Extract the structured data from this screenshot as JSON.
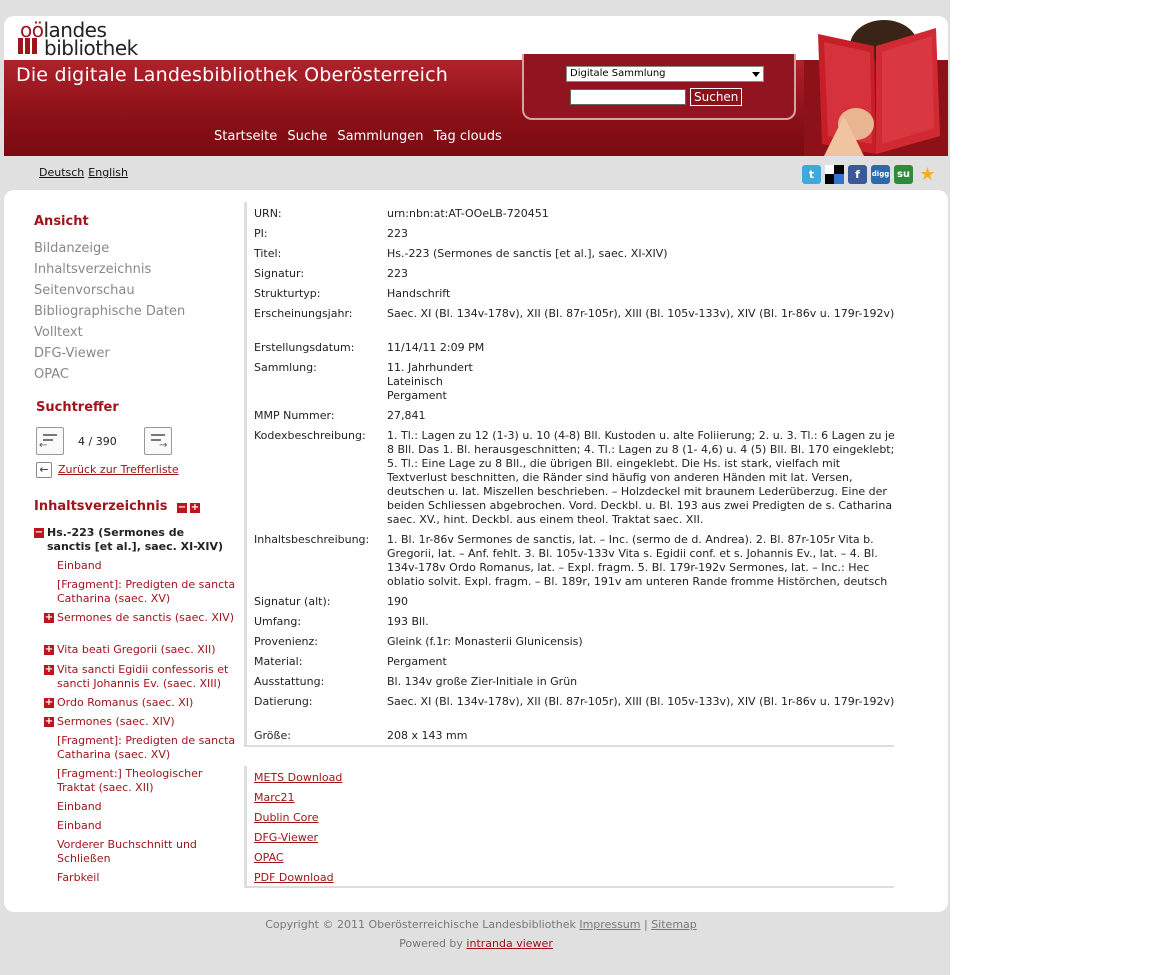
{
  "logo": {
    "oo": "oö",
    "line1": "landes",
    "line2": "bibliothek"
  },
  "banner_title": "Die digitale Landesbibliothek Oberösterreich",
  "search": {
    "select_value": "Digitale Sammlung",
    "button": "Suchen"
  },
  "nav": [
    "Startseite",
    "Suche",
    "Sammlungen",
    "Tag clouds"
  ],
  "languages": [
    "Deutsch",
    "English"
  ],
  "social_icons": [
    "twitter-icon",
    "delicious-icon",
    "facebook-icon",
    "digg-icon",
    "stumbleupon-icon",
    "favorite-star-icon"
  ],
  "colors": {
    "brand": "#a0141c",
    "banner_dark": "#7a0b12"
  },
  "sidebar": {
    "view_heading": "Ansicht",
    "view_items": [
      "Bildanzeige",
      "Inhaltsverzeichnis",
      "Seitenvorschau",
      "Bibliographische Daten",
      "Volltext",
      "DFG-Viewer",
      "OPAC"
    ],
    "hits_heading": "Suchtreffer",
    "hits_position": "4 / 390",
    "back_link": "Zurück zur Trefferliste",
    "toc_heading": "Inhaltsverzeichnis",
    "toc_root": "Hs.-223 (Sermones de sanctis [et al.], saec. XI-XIV)",
    "toc_items": [
      {
        "label": "Einband",
        "expandable": false
      },
      {
        "label": "[Fragment]: Predigten de sancta Catharina (saec. XV)",
        "expandable": false
      },
      {
        "label": "Sermones de sanctis (saec. XIV)",
        "expandable": true
      },
      {
        "label": "Vita beati Gregorii (saec. XII)",
        "expandable": true
      },
      {
        "label": "Vita sancti Egidii confessoris et sancti Johannis Ev. (saec. XIII)",
        "expandable": true
      },
      {
        "label": "Ordo Romanus (saec. XI)",
        "expandable": true
      },
      {
        "label": "Sermones (saec. XIV)",
        "expandable": true
      },
      {
        "label": "[Fragment]: Predigten de sancta Catharina (saec. XV)",
        "expandable": false
      },
      {
        "label": "[Fragment:] Theologischer Traktat (saec. XII)",
        "expandable": false
      },
      {
        "label": "Einband",
        "expandable": false
      },
      {
        "label": "Einband",
        "expandable": false
      },
      {
        "label": "Vorderer Buchschnitt und Schließen",
        "expandable": false
      },
      {
        "label": "Farbkeil",
        "expandable": false
      }
    ]
  },
  "metadata": [
    {
      "key": "URN:",
      "value": "urn:nbn:at:AT-OOeLB-720451"
    },
    {
      "key": "PI:",
      "value": "223"
    },
    {
      "key": "Titel:",
      "value": "Hs.-223 (Sermones de sanctis [et al.], saec. XI-XIV)"
    },
    {
      "key": "Signatur:",
      "value": "223"
    },
    {
      "key": "Strukturtyp:",
      "value": "Handschrift"
    },
    {
      "key": "Erscheinungsjahr:",
      "value": "Saec. XI (Bl. 134v-178v), XII (Bl. 87r-105r), XIII (Bl. 105v-133v), XIV (Bl. 1r-86v u. 179r-192v)"
    },
    {
      "key": "Erstellungsdatum:",
      "value": "11/14/11 2:09 PM"
    },
    {
      "key": "Sammlung:",
      "value": "11. Jahrhundert\nLateinisch\nPergament"
    },
    {
      "key": "MMP Nummer:",
      "value": "27,841"
    },
    {
      "key": "Kodexbeschreibung:",
      "value": "1. Tl.: Lagen zu 12 (1-3) u. 10 (4-8) Bll. Kustoden u. alte Foliierung; 2. u. 3. Tl.: 6 Lagen zu je 8 Bll. Das 1. Bl. herausgeschnitten; 4. Tl.: Lagen zu 8 (1- 4,6) u. 4 (5) Bll. Bl. 170 eingeklebt; 5. Tl.: Eine Lage zu 8 Bll., die übrigen Bll. eingeklebt. Die Hs. ist stark, vielfach mit Textverlust beschnitten, die Ränder sind häufig von anderen Händen mit lat. Versen, deutschen u. lat. Miszellen beschrieben. – Holzdeckel mit braunem Lederüberzug. Eine der beiden Schliessen abgebrochen. Vord. Deckbl. u. Bl. 193 aus zwei Predigten de s. Catharina saec. XV., hint. Deckbl. aus einem theol. Traktat saec. XII."
    },
    {
      "key": "Inhaltsbeschreibung:",
      "value": "1. Bl. 1r-86v Sermones de sanctis, lat. – Inc. (sermo de d. Andrea). 2. Bl. 87r-105r Vita b. Gregorii, lat. – Anf. fehlt. 3. Bl. 105v-133v Vita s. Egidii conf. et s. Johannis Ev., lat. – 4. Bl. 134v-178v Ordo Romanus, lat. – Expl. fragm. 5. Bl. 179r-192v Sermones, lat. – Inc.: Hec oblatio solvit. Expl. fragm. – Bl. 189r, 191v am unteren Rande fromme Histörchen, deutsch"
    },
    {
      "key": "Signatur (alt):",
      "value": "190"
    },
    {
      "key": "Umfang:",
      "value": "193 Bll."
    },
    {
      "key": "Provenienz:",
      "value": "Gleink (f.1r: Monasterii Glunicensis)"
    },
    {
      "key": "Material:",
      "value": "Pergament"
    },
    {
      "key": "Ausstattung:",
      "value": "Bl. 134v große Zier-Initiale in Grün"
    },
    {
      "key": "Datierung:",
      "value": "Saec. XI (Bl. 134v-178v), XII (Bl. 87r-105r), XIII (Bl. 105v-133v), XIV (Bl. 1r-86v u. 179r-192v)"
    },
    {
      "key": "Größe:",
      "value": "208 x 143 mm"
    }
  ],
  "downloads": [
    "METS Download",
    "Marc21",
    "Dublin Core",
    "DFG-Viewer",
    "OPAC",
    "PDF Download"
  ],
  "footer": {
    "copyright": "Copyright © 2011 Oberösterreichische Landesbibliothek",
    "impressum": "Impressum",
    "sep": "|",
    "sitemap": "Sitemap",
    "powered": "Powered by",
    "powered_link": "intranda viewer"
  }
}
